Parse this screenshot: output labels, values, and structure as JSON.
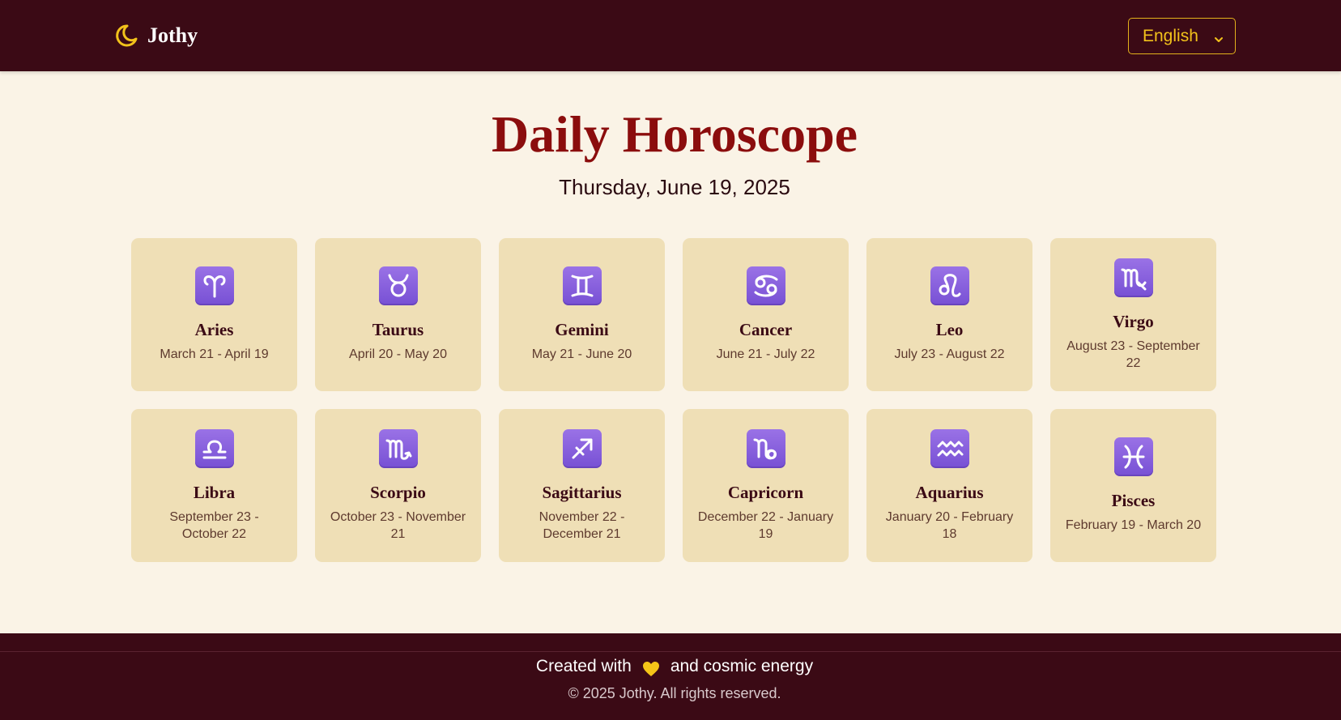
{
  "header": {
    "brand_name": "Jothy",
    "brand_icon": "crescent-moon-icon",
    "language": {
      "selected": "English",
      "icon": "chevron-down-icon"
    }
  },
  "main": {
    "title": "Daily Horoscope",
    "date": "Thursday, June 19, 2025",
    "signs": [
      {
        "name": "Aries",
        "dates": "March 21 - April 19",
        "icon": "aries-icon"
      },
      {
        "name": "Taurus",
        "dates": "April 20 - May 20",
        "icon": "taurus-icon"
      },
      {
        "name": "Gemini",
        "dates": "May 21 - June 20",
        "icon": "gemini-icon"
      },
      {
        "name": "Cancer",
        "dates": "June 21 - July 22",
        "icon": "cancer-icon"
      },
      {
        "name": "Leo",
        "dates": "July 23 - August 22",
        "icon": "leo-icon"
      },
      {
        "name": "Virgo",
        "dates": "August 23 - September 22",
        "icon": "virgo-icon"
      },
      {
        "name": "Libra",
        "dates": "September 23 - October 22",
        "icon": "libra-icon"
      },
      {
        "name": "Scorpio",
        "dates": "October 23 - November 21",
        "icon": "scorpio-icon"
      },
      {
        "name": "Sagittarius",
        "dates": "November 22 - December 21",
        "icon": "sagittarius-icon"
      },
      {
        "name": "Capricorn",
        "dates": "December 22 - January 19",
        "icon": "capricorn-icon"
      },
      {
        "name": "Aquarius",
        "dates": "January 20 - February 18",
        "icon": "aquarius-icon"
      },
      {
        "name": "Pisces",
        "dates": "February 19 - March 20",
        "icon": "pisces-icon"
      }
    ]
  },
  "footer": {
    "created_prefix": "Created with",
    "heart_icon": "heart-icon",
    "created_suffix": "and cosmic energy",
    "copyright": "© 2025 Jothy. All rights reserved."
  },
  "colors": {
    "header_bg": "#3b0a15",
    "page_bg": "#faf3e6",
    "card_bg": "#efdfb6",
    "title": "#8b0d0d",
    "accent_gold": "#f2c21b",
    "icon_purple": "#8a63df"
  }
}
